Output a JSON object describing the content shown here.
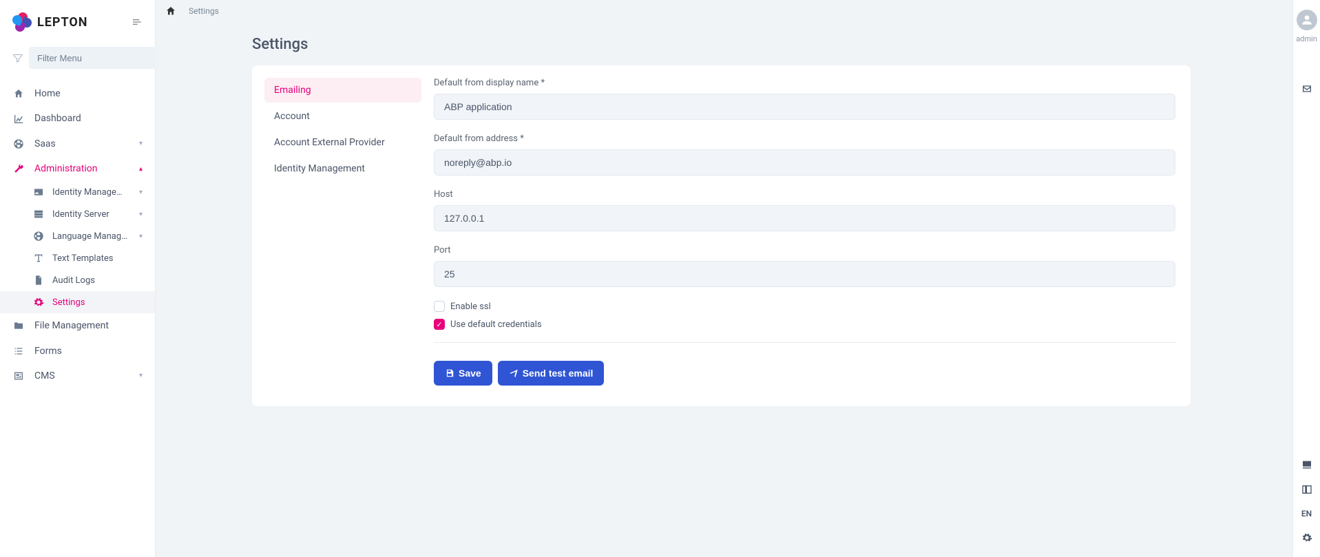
{
  "brand": {
    "name": "LEPTON"
  },
  "sidebar": {
    "filterPlaceholder": "Filter Menu",
    "items": [
      {
        "label": "Home"
      },
      {
        "label": "Dashboard"
      },
      {
        "label": "Saas"
      },
      {
        "label": "Administration"
      },
      {
        "label": "File Management"
      },
      {
        "label": "Forms"
      },
      {
        "label": "CMS"
      }
    ],
    "adminChildren": [
      {
        "label": "Identity Management"
      },
      {
        "label": "Identity Server"
      },
      {
        "label": "Language Managem..."
      },
      {
        "label": "Text Templates"
      },
      {
        "label": "Audit Logs"
      },
      {
        "label": "Settings"
      }
    ]
  },
  "breadcrumb": {
    "current": "Settings"
  },
  "page": {
    "title": "Settings"
  },
  "tabs": [
    {
      "label": "Emailing"
    },
    {
      "label": "Account"
    },
    {
      "label": "Account External Provider"
    },
    {
      "label": "Identity Management"
    }
  ],
  "form": {
    "displayNameLabel": "Default from display name *",
    "displayNameValue": "ABP application",
    "fromAddressLabel": "Default from address *",
    "fromAddressValue": "noreply@abp.io",
    "hostLabel": "Host",
    "hostValue": "127.0.0.1",
    "portLabel": "Port",
    "portValue": "25",
    "enableSslLabel": "Enable ssl",
    "useDefaultCredsLabel": "Use default credentials",
    "saveLabel": "Save",
    "sendTestLabel": "Send test email"
  },
  "rightRail": {
    "userLabel": "admin",
    "langLabel": "EN"
  }
}
